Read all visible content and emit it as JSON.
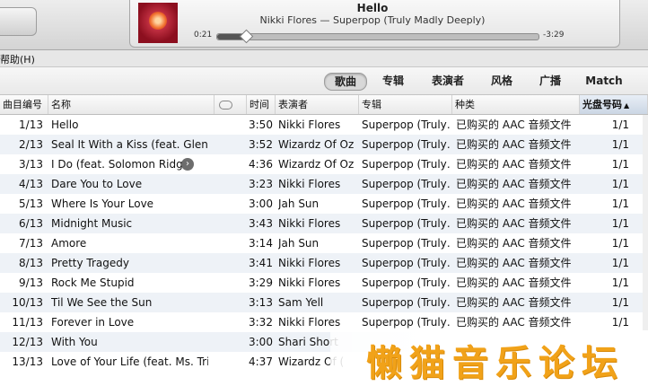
{
  "player": {
    "title": "Hello",
    "subtitle": "Nikki Flores — Superpop (Truly Madly Deeply)",
    "elapsed": "0:21",
    "remaining": "-3:29",
    "progress_fraction": 0.09
  },
  "menubar": {
    "help": "帮助(H)"
  },
  "tabs": [
    {
      "label": "歌曲",
      "active": true
    },
    {
      "label": "专辑",
      "active": false
    },
    {
      "label": "表演者",
      "active": false
    },
    {
      "label": "风格",
      "active": false
    },
    {
      "label": "广播",
      "active": false
    },
    {
      "label": "Match",
      "active": false
    }
  ],
  "columns": {
    "track": "曲目编号",
    "name": "名称",
    "time": "时间",
    "artist": "表演者",
    "album": "专辑",
    "kind": "种类",
    "disc": "光盘号码"
  },
  "rows": [
    {
      "track": "1/13",
      "name": "Hello",
      "time": "3:50",
      "artist": "Nikki Flores",
      "album": "Superpop (Truly…",
      "kind": "已购买的 AAC 音频文件",
      "disc": "1/1"
    },
    {
      "track": "2/13",
      "name": "Seal It With a Kiss (feat. Glenna…",
      "time": "3:52",
      "artist": "Wizardz Of Oz",
      "album": "Superpop (Truly…",
      "kind": "已购买的 AAC 音频文件",
      "disc": "1/1"
    },
    {
      "track": "3/13",
      "name": "I Do (feat. Solomon Ridge)",
      "time": "4:36",
      "artist": "Wizardz Of Oz",
      "album": "Superpop (Truly…",
      "kind": "已购买的 AAC 音频文件",
      "disc": "1/1",
      "has_arrow": true
    },
    {
      "track": "4/13",
      "name": "Dare You to Love",
      "time": "3:23",
      "artist": "Nikki Flores",
      "album": "Superpop (Truly…",
      "kind": "已购买的 AAC 音频文件",
      "disc": "1/1"
    },
    {
      "track": "5/13",
      "name": "Where Is Your Love",
      "time": "3:00",
      "artist": "Jah Sun",
      "album": "Superpop (Truly…",
      "kind": "已购买的 AAC 音频文件",
      "disc": "1/1"
    },
    {
      "track": "6/13",
      "name": "Midnight Music",
      "time": "3:43",
      "artist": "Nikki Flores",
      "album": "Superpop (Truly…",
      "kind": "已购买的 AAC 音频文件",
      "disc": "1/1"
    },
    {
      "track": "7/13",
      "name": "Amore",
      "time": "3:14",
      "artist": "Jah Sun",
      "album": "Superpop (Truly…",
      "kind": "已购买的 AAC 音频文件",
      "disc": "1/1"
    },
    {
      "track": "8/13",
      "name": "Pretty Tragedy",
      "time": "3:41",
      "artist": "Nikki Flores",
      "album": "Superpop (Truly…",
      "kind": "已购买的 AAC 音频文件",
      "disc": "1/1"
    },
    {
      "track": "9/13",
      "name": "Rock Me Stupid",
      "time": "3:29",
      "artist": "Nikki Flores",
      "album": "Superpop (Truly…",
      "kind": "已购买的 AAC 音频文件",
      "disc": "1/1"
    },
    {
      "track": "10/13",
      "name": "Til We See the Sun",
      "time": "3:13",
      "artist": "Sam Yell",
      "album": "Superpop (Truly…",
      "kind": "已购买的 AAC 音频文件",
      "disc": "1/1"
    },
    {
      "track": "11/13",
      "name": "Forever in Love",
      "time": "3:32",
      "artist": "Nikki Flores",
      "album": "Superpop (Truly…",
      "kind": "已购买的 AAC 音频文件",
      "disc": "1/1"
    },
    {
      "track": "12/13",
      "name": "With You",
      "time": "3:00",
      "artist": "Shari Short",
      "album": "",
      "kind": "",
      "disc": ""
    },
    {
      "track": "13/13",
      "name": "Love of Your Life (feat. Ms. Triniti)",
      "time": "4:37",
      "artist": "Wizardz Of (",
      "album": "",
      "kind": "",
      "disc": ""
    }
  ],
  "watermark": "懒猫音乐论坛",
  "colors": {
    "watermark": "#f1a219",
    "row_alt": "#eef2f7",
    "sorted_header": "#cbd6e4"
  },
  "icons": {
    "now_playing_list": "list-icon",
    "cloud_column": "cloud-icon",
    "row_arrow": "arrow-right-icon"
  }
}
